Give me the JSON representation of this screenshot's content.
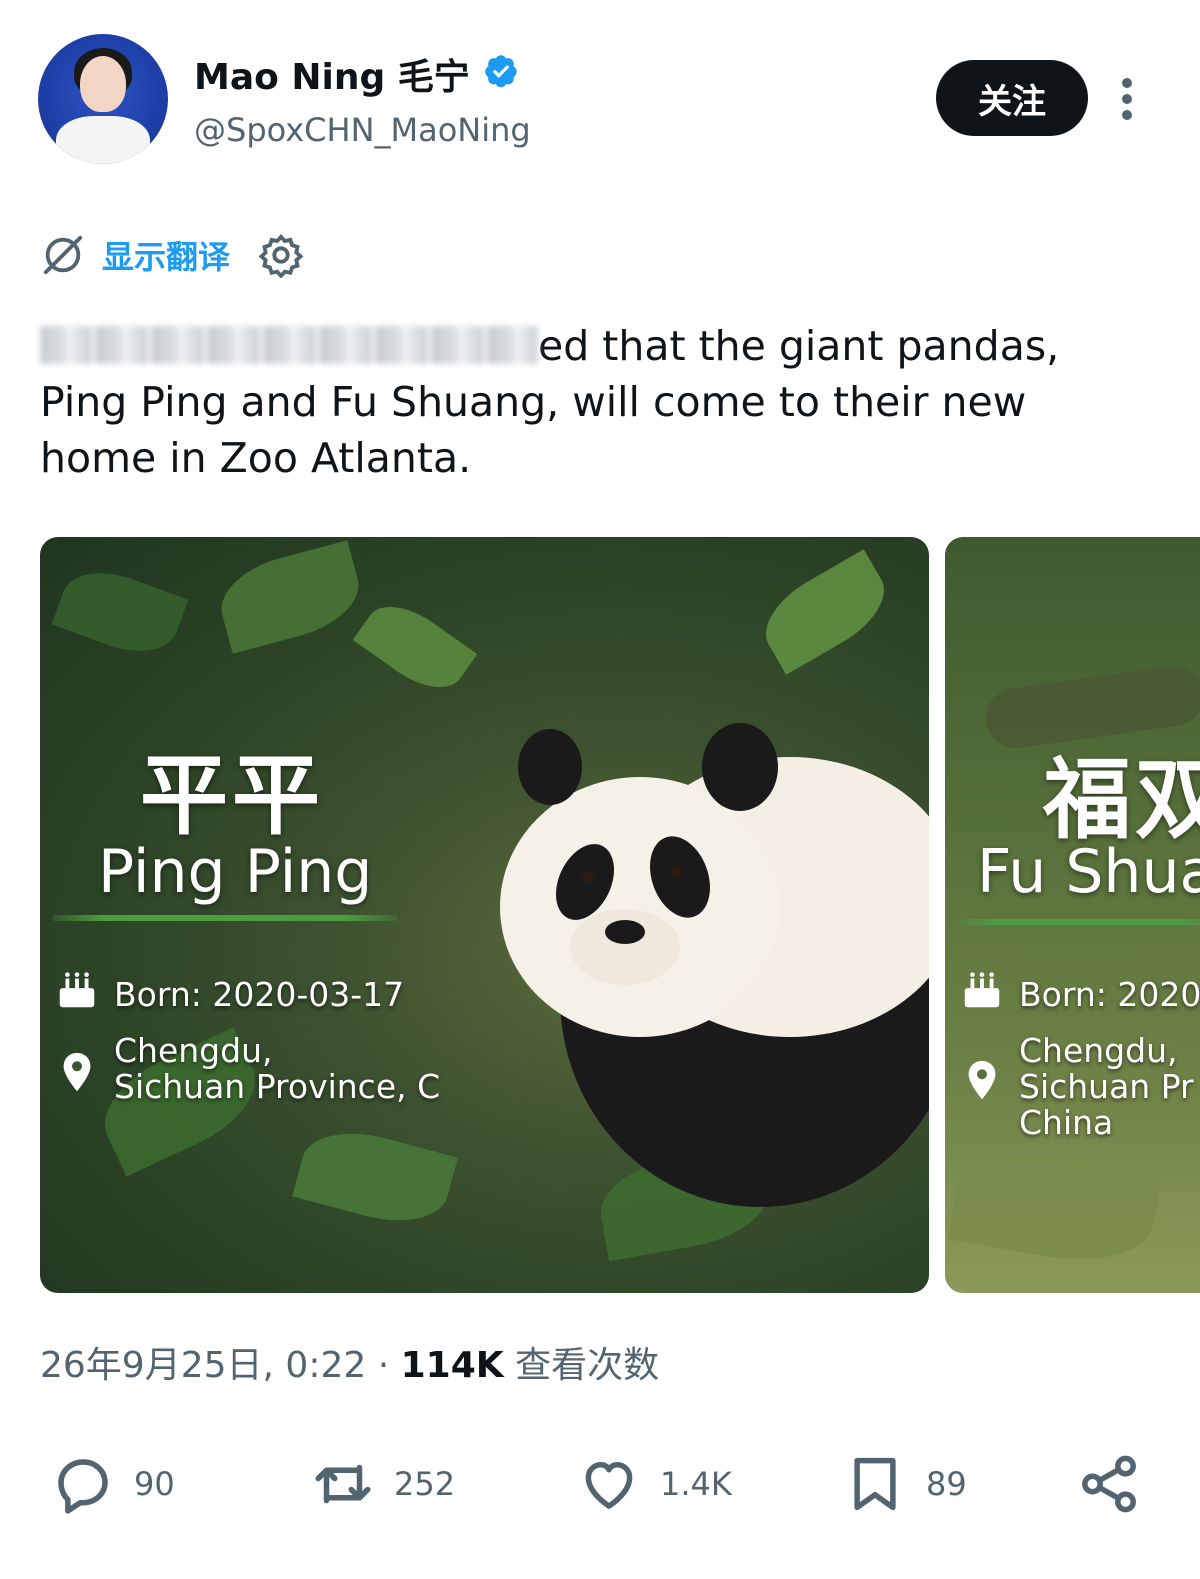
{
  "author": {
    "display_name": "Mao Ning 毛宁",
    "handle": "@SpoxCHN_MaoNing",
    "verified_icon": "verified-badge-icon",
    "avatar_icon": "avatar"
  },
  "header": {
    "follow_label": "关注",
    "more_icon": "more-vertical-icon"
  },
  "translate": {
    "label": "显示翻译",
    "icon": "translate-off-icon",
    "settings_icon": "gear-icon"
  },
  "tweet": {
    "text_visible": "ed that the giant pandas, Ping Ping and Fu Shuang, will come to their new home in Zoo Atlanta."
  },
  "media": {
    "cards": [
      {
        "name_cn": "平平",
        "name_en": "Ping Ping",
        "born": "Born: 2020-03-17",
        "location_line1": "Chengdu,",
        "location_line2": "Sichuan Province, C",
        "location_line3": ""
      },
      {
        "name_cn": "福双",
        "name_en": "Fu Shuang",
        "born": "Born: 2020",
        "location_line1": "Chengdu,",
        "location_line2": "Sichuan Pr",
        "location_line3": "China"
      }
    ]
  },
  "meta": {
    "timestamp": "26年9月25日, 0:22",
    "separator": "·",
    "views_count": "114K",
    "views_label": "查看次数"
  },
  "actions": {
    "reply": {
      "icon": "reply-icon",
      "count": "90"
    },
    "retweet": {
      "icon": "retweet-icon",
      "count": "252"
    },
    "like": {
      "icon": "heart-icon",
      "count": "1.4K"
    },
    "bookmark": {
      "icon": "bookmark-icon",
      "count": "89"
    },
    "share": {
      "icon": "share-icon"
    }
  },
  "colors": {
    "link_blue": "#1d9bf0",
    "text_primary": "#0f1419",
    "text_secondary": "#536471",
    "follow_bg": "#0f1419"
  }
}
